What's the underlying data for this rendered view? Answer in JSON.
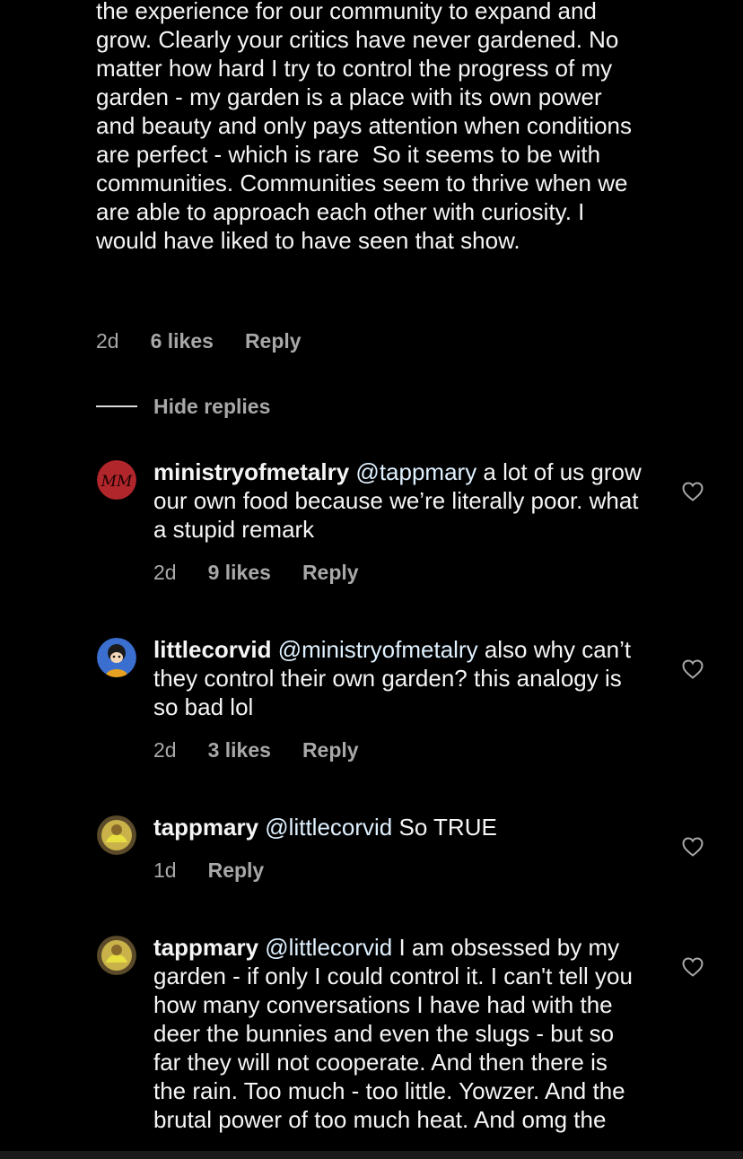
{
  "parent_comment": {
    "text": "the experience for our community to expand and grow. Clearly your critics have never gardened. No matter how hard I try to control the progress of my garden - my garden is a place with its own power and beauty and only pays attention when conditions are perfect - which is rare  So it seems to be with communities. Communities seem to thrive when we are able to approach each other with curiosity. I would have liked to have seen that show.",
    "time": "2d",
    "likes": "6 likes",
    "reply_label": "Reply"
  },
  "hide_replies_label": "Hide replies",
  "replies": [
    {
      "username": "ministryofmetalry",
      "mention": "@tappmary",
      "text": " a lot of us grow our own food because we’re literally poor. what a stupid remark",
      "time": "2d",
      "likes": "9 likes",
      "reply_label": "Reply",
      "avatar_initials": "MM",
      "avatar_color": "#b1262b"
    },
    {
      "username": "littlecorvid",
      "mention": "@ministryofmetalry",
      "text": " also why can’t they control their own garden? this analogy is so bad lol",
      "time": "2d",
      "likes": "3 likes",
      "reply_label": "Reply",
      "avatar_color": "#3a6fd0"
    },
    {
      "username": "tappmary",
      "mention": "@littlecorvid",
      "text": " So TRUE",
      "time": "1d",
      "reply_label": "Reply",
      "avatar_color": "#c9b24a"
    },
    {
      "username": "tappmary",
      "mention": "@littlecorvid",
      "text": " I am obsessed by my garden - if only I could control it. I can't tell you how many conversations I have had with the deer the bunnies and even the slugs - but so far they will not cooperate. And then there is the rain. Too much - too little. Yowzer. And the brutal power of too much heat. And omg the",
      "avatar_color": "#c9b24a"
    }
  ],
  "icons": {
    "like": "heart-outline-icon"
  }
}
